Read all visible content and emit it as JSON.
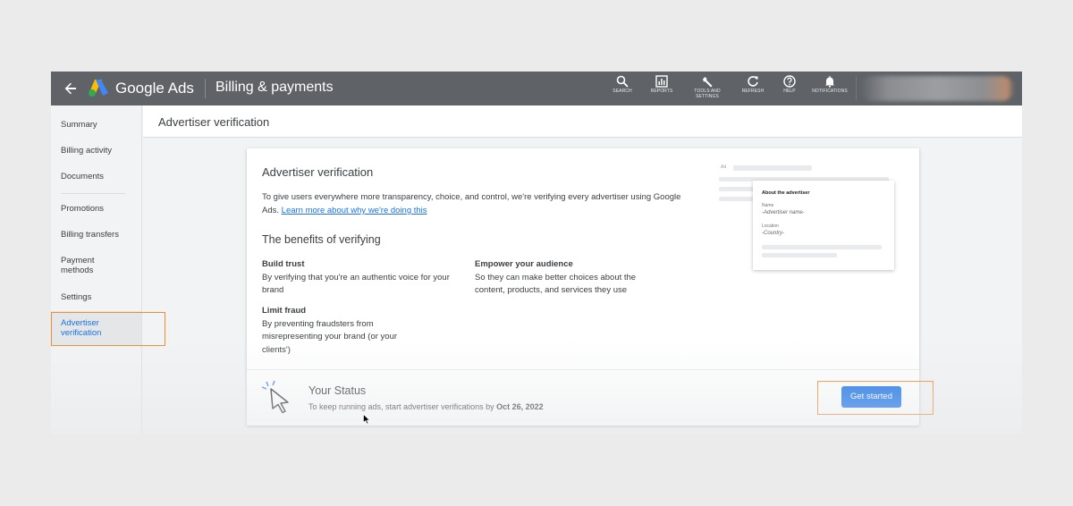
{
  "header": {
    "brand": "Google Ads",
    "section_title": "Billing & payments",
    "tools": [
      {
        "label": "SEARCH",
        "icon": "search-icon"
      },
      {
        "label": "REPORTS",
        "icon": "reports-icon"
      },
      {
        "label": "TOOLS AND SETTINGS",
        "icon": "wrench-icon"
      },
      {
        "label": "REFRESH",
        "icon": "refresh-icon"
      },
      {
        "label": "HELP",
        "icon": "help-icon"
      },
      {
        "label": "NOTIFICATIONS",
        "icon": "bell-icon"
      }
    ]
  },
  "sidebar": {
    "items": [
      {
        "label": "Summary"
      },
      {
        "label": "Billing activity"
      },
      {
        "label": "Documents"
      },
      {
        "label": "Promotions"
      },
      {
        "label": "Billing transfers"
      },
      {
        "label": "Payment methods"
      },
      {
        "label": "Settings"
      },
      {
        "label": "Advertiser verification"
      }
    ],
    "active_index": 7
  },
  "content": {
    "page_title": "Advertiser verification",
    "card": {
      "title": "Advertiser verification",
      "intro": "To give users everywhere more transparency, choice, and control, we're verifying every advertiser using Google Ads.",
      "learn_more": "Learn more about why we're doing this",
      "benefits_title": "The benefits of verifying",
      "benefits": [
        {
          "heading": "Build trust",
          "text": "By verifying that you're an authentic voice for your brand"
        },
        {
          "heading": "Empower your audience",
          "text": "So they can make better choices about the content, products, and services they use"
        },
        {
          "heading": "Limit fraud",
          "text": "By preventing fraudsters from misrepresenting your brand (or your clients')"
        }
      ],
      "preview": {
        "ad_label": "Ad",
        "title": "About the advertiser",
        "name_label": "Name",
        "name_value": "-Advertiser name-",
        "location_label": "Location",
        "location_value": "-Country-"
      },
      "status": {
        "title": "Your Status",
        "text_prefix": "To keep running ads, start advertiser verifications by",
        "deadline": "Oct 26, 2022",
        "button": "Get started"
      }
    }
  },
  "colors": {
    "topbar": "#5f6368",
    "primary": "#1a73e8",
    "highlight": "#f08c32",
    "logo_blue": "#4285f4",
    "logo_yellow": "#fbbc04",
    "logo_green": "#34a853"
  }
}
